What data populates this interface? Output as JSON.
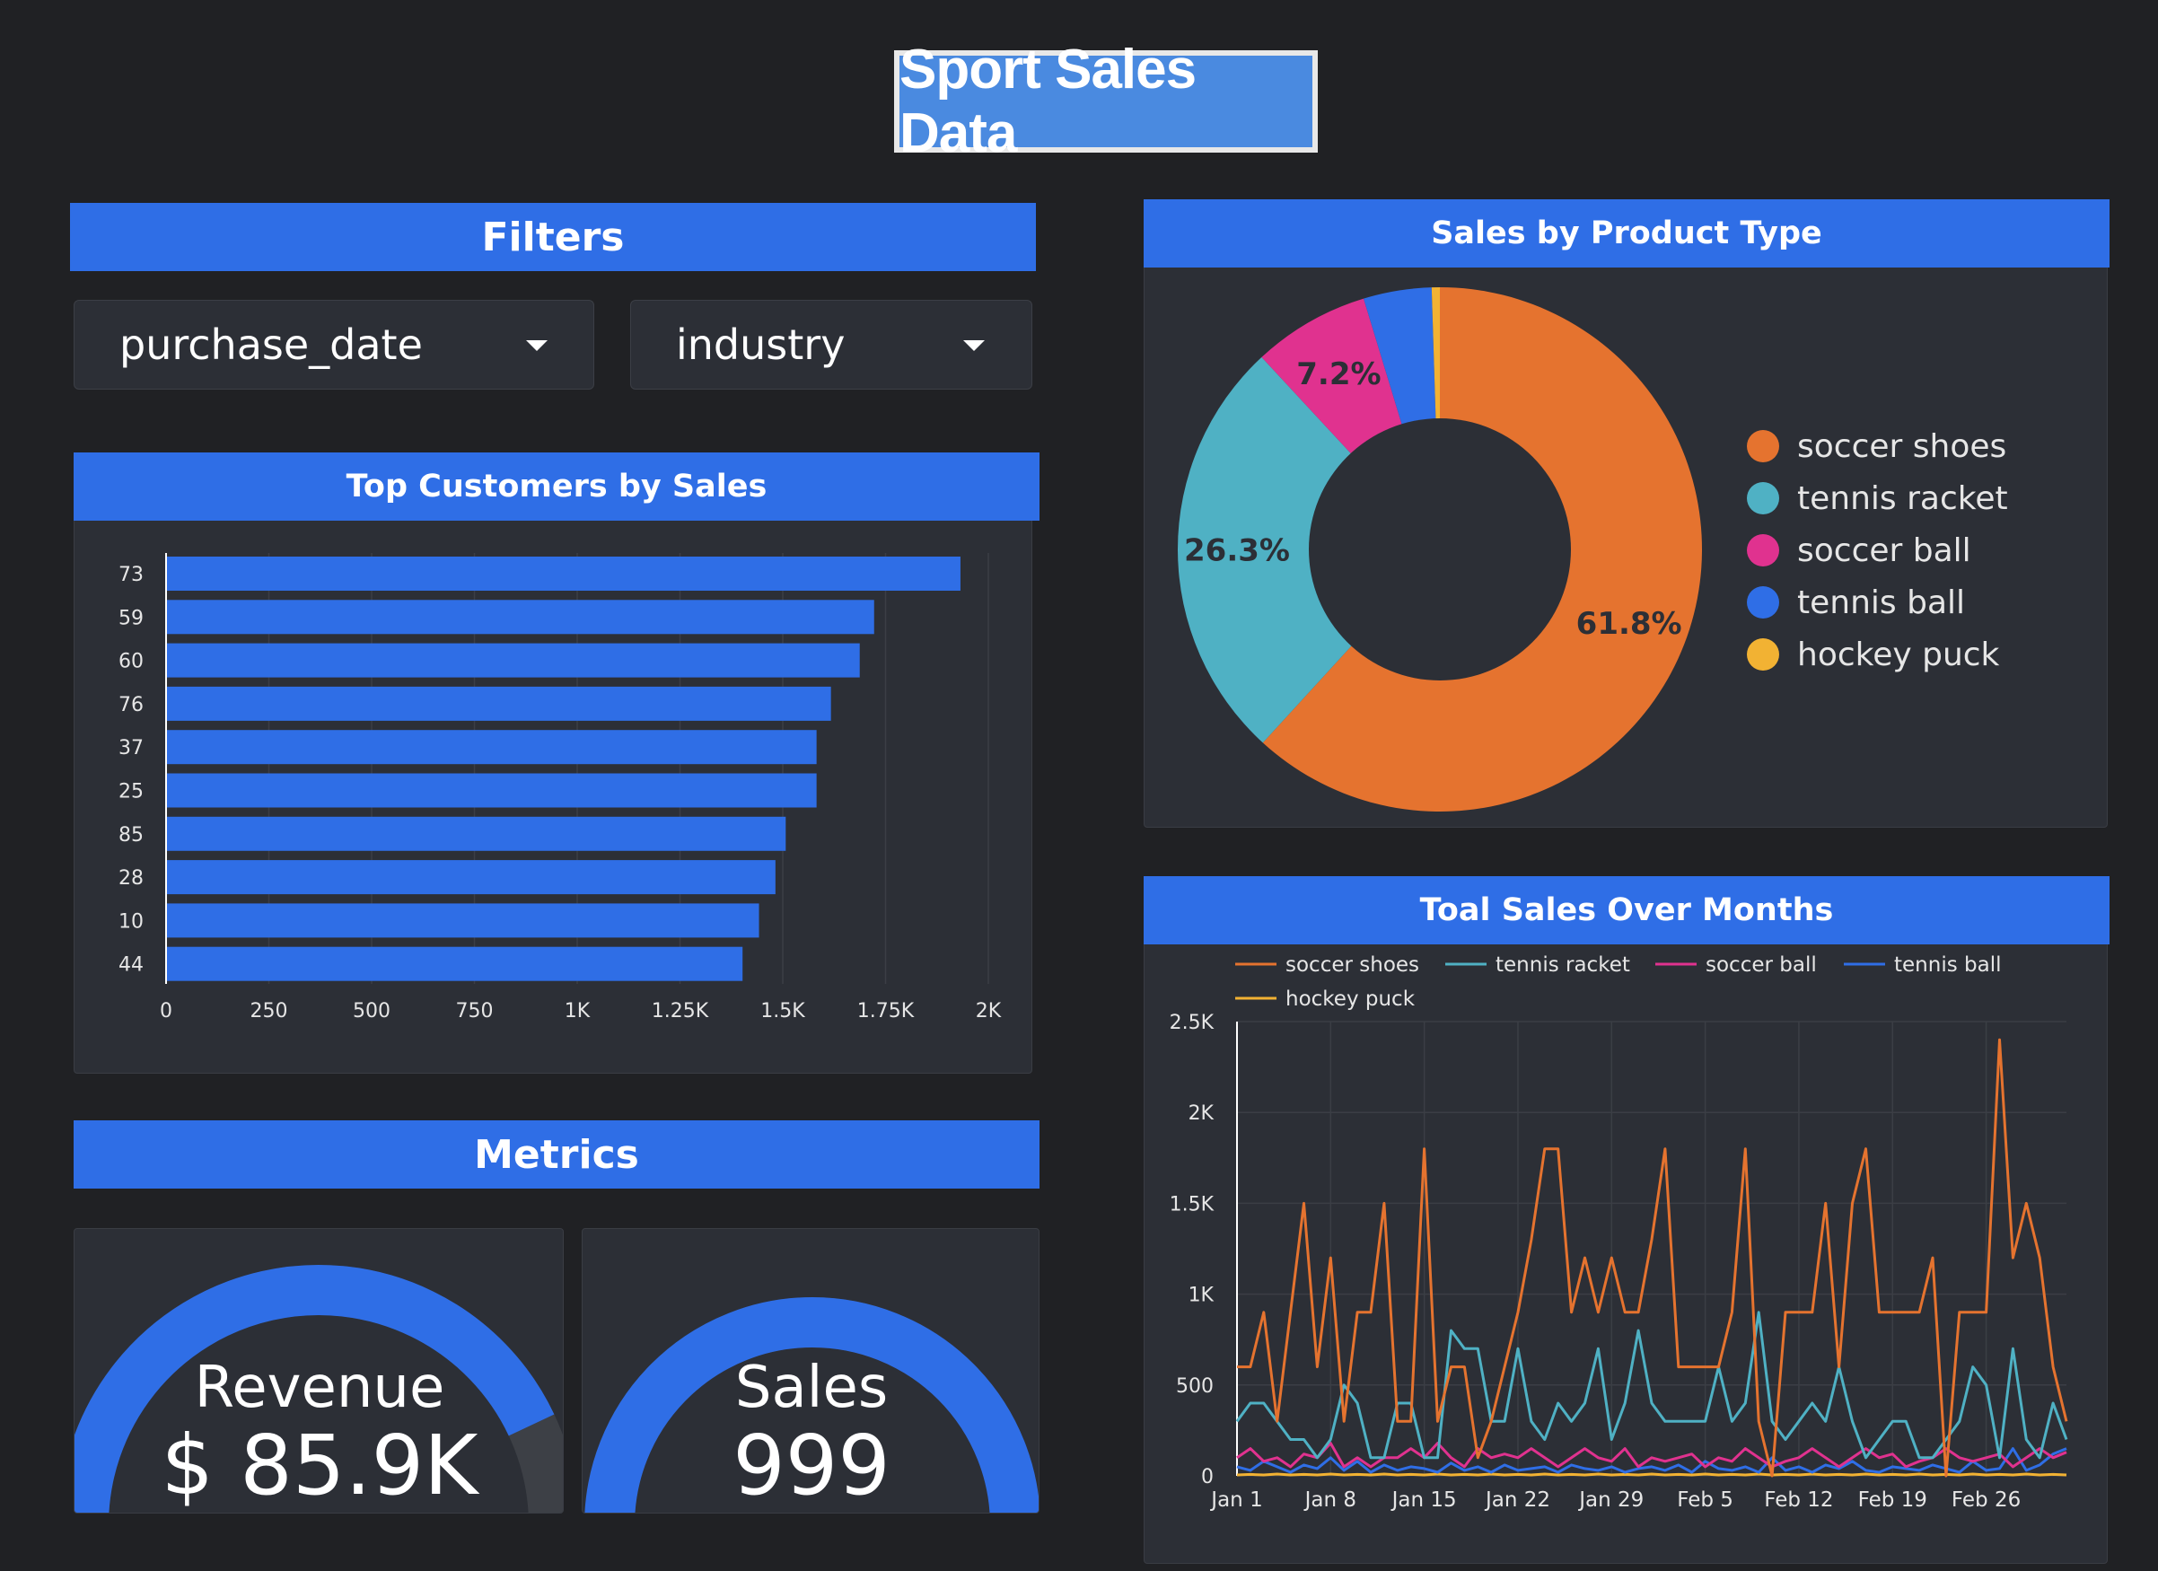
{
  "title": "Sport Sales Data",
  "filters": {
    "title": "Filters",
    "dropdowns": [
      {
        "label": "purchase_date",
        "icon": "caret-down-icon"
      },
      {
        "label": "industry",
        "icon": "caret-down-icon"
      }
    ]
  },
  "top_customers": {
    "title": "Top Customers by Sales"
  },
  "product_type": {
    "title": "Sales by Product Type"
  },
  "sales_months": {
    "title": "Toal Sales Over Months"
  },
  "metrics": {
    "title": "Metrics",
    "revenue": {
      "label": "Revenue",
      "value": "$ 85.9K",
      "gauge_fraction": 0.86
    },
    "sales": {
      "label": "Sales",
      "value": "999",
      "gauge_fraction": 1.0
    }
  },
  "colors": {
    "accent": "#2f6ee6",
    "soccer_shoes": "#e5732f",
    "tennis_racket": "#4fb1c4",
    "soccer_ball": "#e0328f",
    "tennis_ball": "#2f6ee6",
    "hockey_puck": "#f2b233"
  },
  "chart_data": [
    {
      "type": "bar",
      "orientation": "horizontal",
      "categories": [
        "73",
        "59",
        "60",
        "76",
        "37",
        "25",
        "85",
        "28",
        "10",
        "44"
      ],
      "values": [
        1930,
        1720,
        1685,
        1615,
        1580,
        1580,
        1505,
        1480,
        1440,
        1400
      ],
      "xlim": [
        0,
        2000
      ],
      "xticks": [
        "0",
        "250",
        "500",
        "750",
        "1K",
        "1.25K",
        "1.5K",
        "1.75K",
        "2K"
      ],
      "grid": true
    },
    {
      "type": "pie",
      "donut": true,
      "labels": [
        "soccer shoes",
        "tennis racket",
        "soccer ball",
        "tennis ball",
        "hockey puck"
      ],
      "values": [
        61.8,
        26.3,
        7.2,
        4.2,
        0.5
      ],
      "slice_labels": [
        "61.8%",
        "26.3%",
        "7.2%",
        "",
        ""
      ],
      "legend": "right"
    },
    {
      "type": "line",
      "xticks": [
        "Jan 1",
        "Jan 8",
        "Jan 15",
        "Jan 22",
        "Jan 29",
        "Feb 5",
        "Feb 12",
        "Feb 19",
        "Feb 26"
      ],
      "yticks": [
        "0",
        "500",
        "1K",
        "1.5K",
        "2K",
        "2.5K"
      ],
      "ylim": [
        0,
        2500
      ],
      "legend": "top",
      "series": [
        {
          "name": "soccer shoes",
          "values": [
            600,
            600,
            900,
            300,
            900,
            1500,
            600,
            1200,
            300,
            900,
            900,
            1500,
            300,
            300,
            1800,
            300,
            600,
            600,
            100,
            300,
            600,
            900,
            1300,
            1800,
            1800,
            900,
            1200,
            900,
            1200,
            900,
            900,
            1300,
            1800,
            600,
            600,
            600,
            600,
            900,
            1800,
            300,
            0,
            900,
            900,
            900,
            1500,
            600,
            1500,
            1800,
            900,
            900,
            900,
            900,
            1200,
            0,
            900,
            900,
            900,
            2400,
            1200,
            1500,
            1200,
            600,
            300
          ]
        },
        {
          "name": "tennis racket",
          "values": [
            300,
            400,
            400,
            300,
            200,
            200,
            100,
            200,
            500,
            400,
            100,
            100,
            400,
            400,
            100,
            100,
            800,
            700,
            700,
            300,
            300,
            700,
            300,
            200,
            400,
            300,
            400,
            700,
            200,
            400,
            800,
            400,
            300,
            300,
            300,
            300,
            600,
            300,
            400,
            900,
            300,
            200,
            300,
            400,
            300,
            600,
            300,
            100,
            200,
            300,
            300,
            100,
            100,
            200,
            300,
            600,
            500,
            100,
            700,
            200,
            100,
            400,
            200
          ]
        },
        {
          "name": "soccer ball",
          "values": [
            100,
            150,
            80,
            100,
            50,
            120,
            100,
            180,
            50,
            100,
            50,
            100,
            100,
            150,
            100,
            180,
            100,
            50,
            150,
            100,
            120,
            100,
            150,
            100,
            50,
            100,
            150,
            100,
            80,
            150,
            50,
            100,
            80,
            100,
            120,
            50,
            100,
            80,
            150,
            100,
            50,
            80,
            100,
            150,
            100,
            50,
            100,
            150,
            100,
            120,
            50,
            80,
            100,
            150,
            100,
            80,
            100,
            120,
            50,
            100,
            150,
            100,
            130
          ]
        },
        {
          "name": "tennis ball",
          "values": [
            50,
            30,
            80,
            50,
            20,
            60,
            40,
            100,
            30,
            80,
            20,
            60,
            30,
            50,
            40,
            20,
            70,
            30,
            50,
            20,
            60,
            30,
            40,
            50,
            20,
            60,
            40,
            30,
            50,
            20,
            40,
            50,
            30,
            60,
            20,
            80,
            40,
            30,
            50,
            20,
            100,
            30,
            50,
            20,
            60,
            40,
            80,
            30,
            20,
            50,
            40,
            30,
            60,
            40,
            20,
            80,
            30,
            40,
            150,
            30,
            60,
            120,
            150
          ]
        },
        {
          "name": "hockey puck",
          "values": [
            5,
            8,
            5,
            10,
            5,
            8,
            5,
            10,
            5,
            8,
            5,
            10,
            5,
            8,
            5,
            10,
            5,
            8,
            5,
            10,
            5,
            8,
            5,
            10,
            5,
            8,
            5,
            10,
            5,
            8,
            5,
            10,
            5,
            8,
            5,
            10,
            5,
            8,
            5,
            10,
            5,
            8,
            5,
            10,
            5,
            8,
            5,
            10,
            5,
            8,
            5,
            10,
            5,
            8,
            5,
            10,
            5,
            8,
            5,
            10,
            5,
            8,
            5
          ]
        }
      ]
    }
  ]
}
